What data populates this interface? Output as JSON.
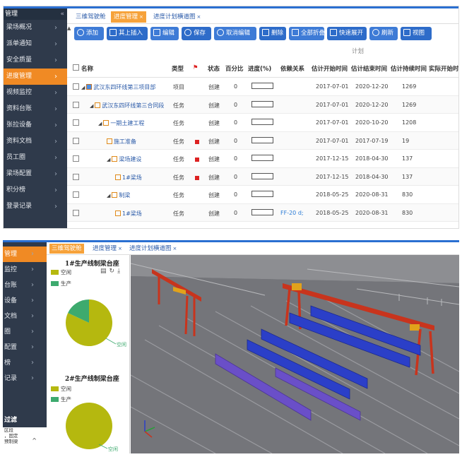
{
  "top": {
    "sidebar": {
      "header": "管理",
      "items": [
        {
          "label": "梁场概况",
          "active": false
        },
        {
          "label": "派单通知",
          "active": false
        },
        {
          "label": "安全质量",
          "active": false
        },
        {
          "label": "进度管理",
          "active": true
        },
        {
          "label": "视频监控",
          "active": false
        },
        {
          "label": "资料台账",
          "active": false
        },
        {
          "label": "张拉设备",
          "active": false
        },
        {
          "label": "资料文档",
          "active": false
        },
        {
          "label": "员工圈",
          "active": false
        },
        {
          "label": "梁场配置",
          "active": false
        },
        {
          "label": "积分榜",
          "active": false
        },
        {
          "label": "登录记录",
          "active": false
        }
      ]
    },
    "tabs": [
      {
        "label": "三维驾驶舱",
        "active": false,
        "closable": false
      },
      {
        "label": "进度管理",
        "active": true,
        "closable": true
      },
      {
        "label": "进度计划横道图",
        "active": false,
        "closable": true
      }
    ],
    "toolbar": [
      {
        "label": "添加",
        "icon": "plus-circle-icon"
      },
      {
        "label": "其上插入",
        "icon": "insert-icon"
      },
      {
        "label": "编辑",
        "icon": "pencil-icon"
      },
      {
        "label": "保存",
        "icon": "check-circle-icon"
      },
      {
        "label": "取消编辑",
        "icon": "cancel-circle-icon"
      },
      {
        "label": "删除",
        "icon": "trash-icon"
      },
      {
        "label": "全部折叠",
        "icon": "collapse-icon"
      },
      {
        "label": "快速展开",
        "icon": "expand-icon"
      },
      {
        "label": "刷新",
        "icon": "refresh-icon"
      },
      {
        "label": "视图",
        "icon": "view-icon"
      }
    ],
    "plan_group": "计划",
    "columns": [
      "名称",
      "类型",
      "",
      "状态",
      "百分比",
      "进度(%)",
      "依赖关系",
      "估计开始时间",
      "估计结束时间",
      "估计持续时间",
      "实际开始时"
    ],
    "rows": [
      {
        "indent": 0,
        "toggle": "◢",
        "icon": "project",
        "name": "武汉东四环线第三项目部",
        "type": "项目",
        "flag": false,
        "status": "创建",
        "pct": "0",
        "dep": "",
        "start": "2017-07-01",
        "end": "2020-12-20",
        "dur": "1269"
      },
      {
        "indent": 1,
        "toggle": "◢",
        "icon": "task",
        "name": "武汉东四环线第三合同段",
        "type": "任务",
        "flag": false,
        "status": "创建",
        "pct": "0",
        "dep": "",
        "start": "2017-07-01",
        "end": "2020-12-20",
        "dur": "1269"
      },
      {
        "indent": 2,
        "toggle": "◢",
        "icon": "task",
        "name": "一期土建工程",
        "type": "任务",
        "flag": false,
        "status": "创建",
        "pct": "0",
        "dep": "",
        "start": "2017-07-01",
        "end": "2020-10-20",
        "dur": "1208"
      },
      {
        "indent": 3,
        "toggle": "",
        "icon": "task",
        "name": "施工准备",
        "type": "任务",
        "flag": true,
        "status": "创建",
        "pct": "0",
        "dep": "",
        "start": "2017-07-01",
        "end": "2017-07-19",
        "dur": "19"
      },
      {
        "indent": 3,
        "toggle": "◢",
        "icon": "task",
        "name": "梁场建设",
        "type": "任务",
        "flag": true,
        "status": "创建",
        "pct": "0",
        "dep": "",
        "start": "2017-12-15",
        "end": "2018-04-30",
        "dur": "137"
      },
      {
        "indent": 4,
        "toggle": "",
        "icon": "task",
        "name": "1#梁场",
        "type": "任务",
        "flag": true,
        "status": "创建",
        "pct": "0",
        "dep": "",
        "start": "2017-12-15",
        "end": "2018-04-30",
        "dur": "137"
      },
      {
        "indent": 3,
        "toggle": "◢",
        "icon": "task",
        "name": "制梁",
        "type": "任务",
        "flag": false,
        "status": "创建",
        "pct": "0",
        "dep": "",
        "start": "2018-05-25",
        "end": "2020-08-31",
        "dur": "830"
      },
      {
        "indent": 4,
        "toggle": "",
        "icon": "task",
        "name": "1#梁场",
        "type": "任务",
        "flag": false,
        "status": "创建",
        "pct": "0",
        "dep": "FF-20 d;",
        "start": "2018-05-25",
        "end": "2020-08-31",
        "dur": "830"
      }
    ]
  },
  "bottom": {
    "sidebar": {
      "items": [
        {
          "label": "管理",
          "active": true
        },
        {
          "label": "监控",
          "active": false
        },
        {
          "label": "台账",
          "active": false
        },
        {
          "label": "设备",
          "active": false
        },
        {
          "label": "文档",
          "active": false
        },
        {
          "label": "圈",
          "active": false
        },
        {
          "label": "配置",
          "active": false
        },
        {
          "label": "榜",
          "active": false
        },
        {
          "label": "记录",
          "active": false
        }
      ],
      "filter_title": "过滤",
      "filter_lines": [
        "区段",
        "，固定",
        "预制梁"
      ]
    },
    "tabs": [
      {
        "label": "三维驾驶舱",
        "active": true,
        "closable": false
      },
      {
        "label": "进度管理",
        "active": false,
        "closable": true
      },
      {
        "label": "进度计划横道图",
        "active": false,
        "closable": true
      }
    ],
    "colors": {
      "idle": "#b5b80f",
      "production": "#3daa6e"
    },
    "charts": [
      {
        "title": "1#生产线制梁台座",
        "legend": [
          "空闲",
          "生产"
        ],
        "slice_label": "空闲",
        "slice_label_2": "生产",
        "idle": 0.82,
        "production": 0.18
      },
      {
        "title": "2#生产线制梁台座",
        "legend": [
          "空闲",
          "生产"
        ],
        "slice_label": "空闲",
        "idle": 1.0,
        "production": 0.0
      }
    ],
    "scene": {
      "description_icon": "3d-beam-yard-scene"
    }
  }
}
